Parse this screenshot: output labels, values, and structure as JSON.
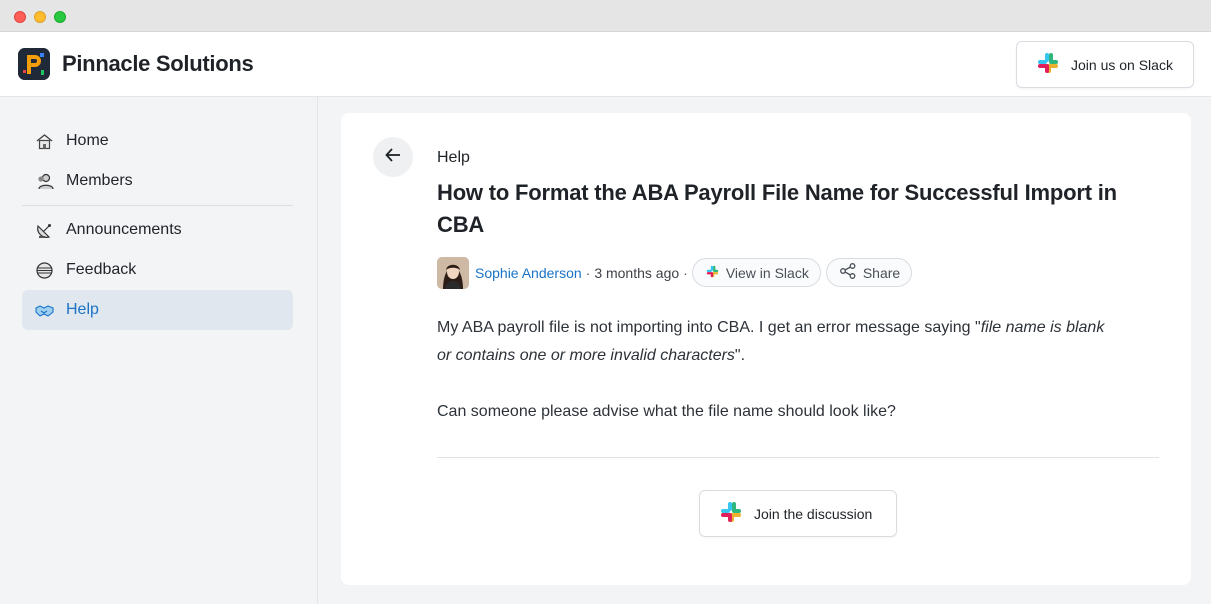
{
  "app": {
    "brand": "Pinnacle Solutions",
    "slack_button": "Join us on Slack"
  },
  "sidebar": {
    "items": [
      {
        "label": "Home",
        "icon": "home-icon"
      },
      {
        "label": "Members",
        "icon": "members-icon"
      },
      {
        "label": "Announcements",
        "icon": "satellite-icon"
      },
      {
        "label": "Feedback",
        "icon": "globe-icon"
      },
      {
        "label": "Help",
        "icon": "handshake-icon",
        "active": true
      }
    ]
  },
  "post": {
    "crumb": "Help",
    "title": "How to Format the ABA Payroll File Name for Successful Import in CBA",
    "author": "Sophie Anderson",
    "separator": "·",
    "time": "3 months ago",
    "view_in_slack": "View in Slack",
    "share": "Share",
    "body_intro": "My ABA payroll file is not importing into CBA. I get an error message saying \"",
    "body_quote": "file name is blank or contains one or more invalid characters",
    "body_outro": "\".",
    "body_question": "Can someone please advise what the file name should look like?",
    "join_discussion": "Join the discussion"
  },
  "colors": {
    "accent": "#1a73c7",
    "active_bg": "#e1e7ef",
    "slack_blue": "#36c5f0",
    "slack_green": "#2eb67d",
    "slack_red": "#e01e5a",
    "slack_yellow": "#ecb22e"
  }
}
